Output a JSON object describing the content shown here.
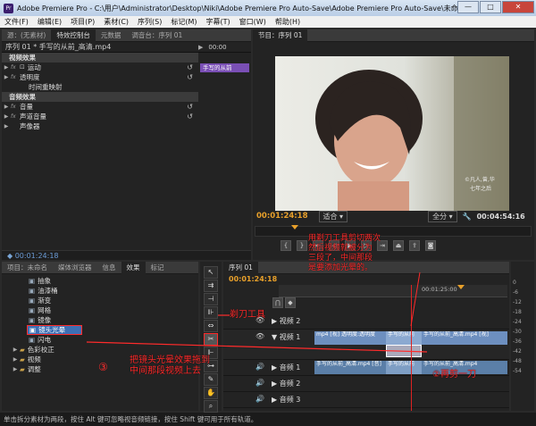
{
  "window": {
    "title": "Adobe Premiere Pro - C:\\用户\\Administrator\\Desktop\\Niki\\Adobe Premiere Pro Auto-Save\\Adobe Premiere Pro Auto-Save\\未命名 *",
    "app_icon": "Pr",
    "controls": [
      "—",
      "□",
      "✕"
    ]
  },
  "menu": [
    "文件(F)",
    "编辑(E)",
    "项目(P)",
    "素材(C)",
    "序列(S)",
    "标记(M)",
    "字幕(T)",
    "窗口(W)",
    "帮助(H)"
  ],
  "effect_controls": {
    "tabs": [
      "源：(无素材)",
      "特效控制台",
      "元数据",
      "调音台：序列 01"
    ],
    "clip_title": "序列 01 * 手写的从前_高清.mp4",
    "timecode_top": "00:00",
    "clip_label": "手写的从前",
    "video_header": "视频效果",
    "video_rows": [
      "运动",
      "透明度",
      "时间重映射"
    ],
    "audio_header": "音频效果",
    "audio_rows": [
      "音量",
      "声道音量",
      "声像器"
    ],
    "current_time": "00:01:24:18"
  },
  "program_monitor": {
    "tab": "节目：序列 01",
    "timecode": "00:01:24:18",
    "zoom": "适合",
    "quality": "全分",
    "duration": "00:04:54:16",
    "watermark": "©凡人,曾,华\n七年之后"
  },
  "project_panel": {
    "tabs": [
      "项目：未命名",
      "媒体浏览器",
      "信息",
      "效果",
      "标记"
    ],
    "items": [
      "抽象",
      "油漆桶",
      "渐变",
      "网格",
      "镜像",
      "镜头光晕",
      "闪电"
    ],
    "selected": "镜头光晕",
    "folders": [
      "色彩校正",
      "视频",
      "调整"
    ]
  },
  "timeline": {
    "tab": "序列 01",
    "timecode": "00:01:24:18",
    "ruler_label": "00:01:25:00",
    "tracks": [
      "视频 2",
      "视频 1",
      "音频 1",
      "音频 2",
      "音频 3"
    ],
    "clips": {
      "v1_a": "mp4 [视] 透明度:透明度",
      "v1_b": "手写的从前",
      "v1_c": "手写的从前_高清.mp4 [视]",
      "a1_a": "手写的从前_高清.mp4 [音]",
      "a1_b": "手写的从前",
      "a1_c": "手写的从前_高清.mp4"
    }
  },
  "meter": {
    "ticks": [
      "0",
      "-6",
      "-12",
      "-18",
      "-24",
      "-30",
      "-36",
      "-42",
      "-48",
      "-54"
    ]
  },
  "status": "单击拆分素材为两段，按住 Alt 键可忽略视音频链接，按住 Shift 键可用于所有轨道。",
  "annotations": {
    "top": "用剃刀工具剪切两次\n然后视频就被分为\n三段了，中间那段\n是要添加光晕的。",
    "razor": "剃刀工具",
    "drag": "把镜头光晕效果拖到\n中间那段视频上去",
    "num": "③",
    "cut": "②再剪一刀"
  },
  "colors": {
    "accent": "#e8a02a",
    "annot": "#ff2b2b",
    "selected_row": "#3d6fb4"
  }
}
